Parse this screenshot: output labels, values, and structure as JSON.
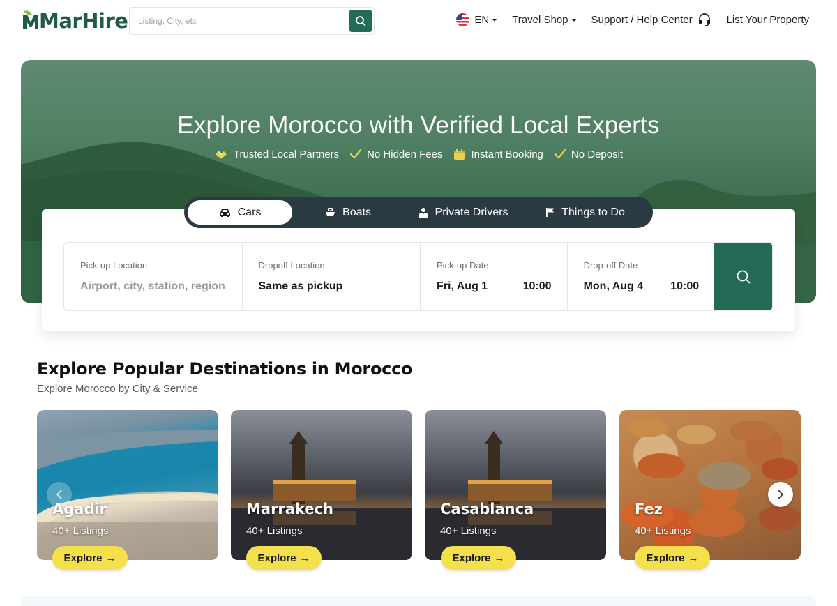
{
  "header": {
    "logo_text": "MarHire",
    "search_placeholder": "Listing, City, etc",
    "nav": {
      "language": "EN",
      "travel_shop": "Travel Shop",
      "support": "Support / Help Center",
      "list_property": "List Your Property"
    }
  },
  "hero": {
    "title": "Explore Morocco with Verified Local Experts",
    "features": [
      {
        "label": "Trusted Local Partners",
        "icon": "handshake-icon"
      },
      {
        "label": "No Hidden Fees",
        "icon": "check-icon"
      },
      {
        "label": "Instant Booking",
        "icon": "calendar-icon"
      },
      {
        "label": "No Deposit",
        "icon": "check-icon"
      }
    ]
  },
  "booking": {
    "tabs": [
      {
        "label": "Cars",
        "icon": "car-icon",
        "active": true
      },
      {
        "label": "Boats",
        "icon": "boat-icon",
        "active": false
      },
      {
        "label": "Private Drivers",
        "icon": "driver-icon",
        "active": false
      },
      {
        "label": "Things to Do",
        "icon": "flag-icon",
        "active": false
      }
    ],
    "fields": {
      "pickup_location": {
        "label": "Pick-up Location",
        "placeholder": "Airport, city, station, region"
      },
      "dropoff_location": {
        "label": "Dropoff Location",
        "value": "Same as pickup"
      },
      "pickup_date": {
        "label": "Pick-up Date",
        "date": "Fri, Aug 1",
        "time": "10:00"
      },
      "dropoff_date": {
        "label": "Drop-off Date",
        "date": "Mon, Aug 4",
        "time": "10:00"
      }
    }
  },
  "destinations": {
    "title": "Explore Popular Destinations in Morocco",
    "subtitle": "Explore Morocco by City & Service",
    "items": [
      {
        "name": "Agadir",
        "count": "40+ Listings",
        "cta": "Explore"
      },
      {
        "name": "Marrakech",
        "count": "40+ Listings",
        "cta": "Explore"
      },
      {
        "name": "Casablanca",
        "count": "40+ Listings",
        "cta": "Explore"
      },
      {
        "name": "Fez",
        "count": "40+ Listings",
        "cta": "Explore"
      }
    ]
  },
  "colors": {
    "brand_green": "#236b57",
    "tab_bar": "#2a3a42",
    "explore_yellow": "#f4e04d",
    "check_yellow": "#e8d24a"
  }
}
